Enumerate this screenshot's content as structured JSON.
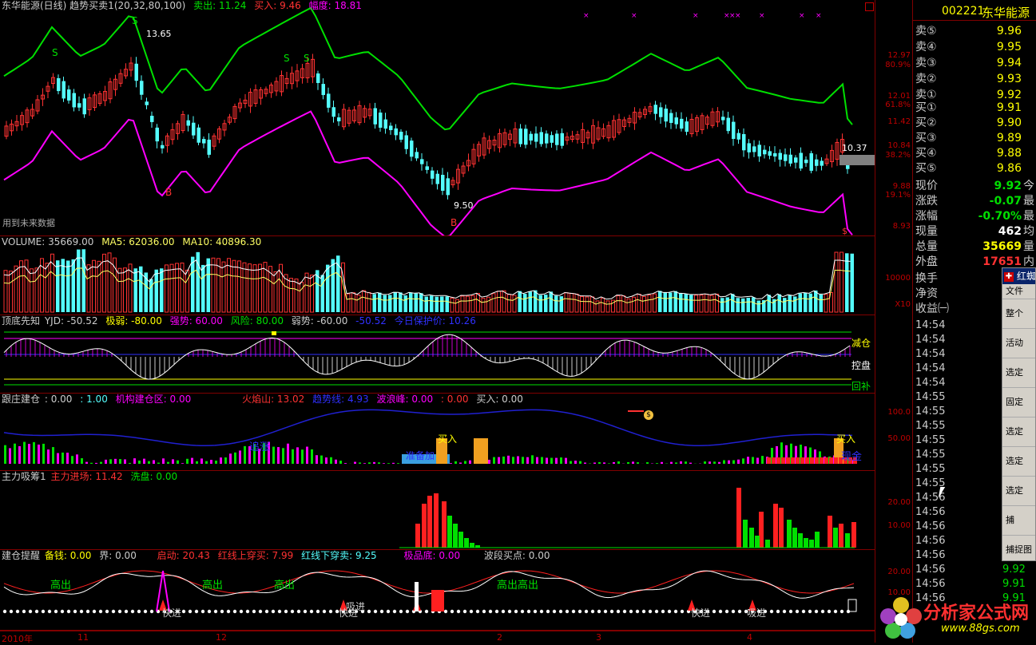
{
  "main_chart": {
    "title": "东华能源(日线) 趋势买卖1(20,32,80,100)",
    "sell_label": "卖出: 11.24",
    "buy_label": "买入: 9.46",
    "range_label": "幅度: 18.81",
    "future_data_note": "用到未来数据",
    "high_mark": "13.65",
    "low_mark": "9.50",
    "last_mark": "10.37",
    "markers": {
      "s": "S",
      "b": "B"
    },
    "price_axis": [
      "12.97",
      "80.9%",
      "12.01",
      "61.8%",
      "11.42",
      "10.84",
      "38.2%",
      "9.88",
      "19.1%",
      "8.93"
    ],
    "colors": {
      "up": "#ff3232",
      "down": "#54fcfc",
      "upper_band": "#00e000",
      "lower_band": "#ff00ff"
    }
  },
  "volume_panel": {
    "label": "VOLUME: 35669.00",
    "ma5": "MA5: 62036.00",
    "ma10": "MA10: 40896.30",
    "axis": [
      "10000",
      "X10"
    ]
  },
  "dingdi_panel": {
    "name": "顶底先知",
    "yjd": "YJD: -50.52",
    "jiruo": "极弱: -80.00",
    "qiangshi": "强势: 60.00",
    "fengxian": "风险: 80.00",
    "ruoshi": "弱势: -60.00",
    "val": "-50.52",
    "baohu": "今日保护价: 10.26",
    "tags": [
      "减仓",
      "控盘",
      "回补"
    ]
  },
  "genzhuang_panel": {
    "name": "跟庄建仓",
    "v1": ": 0.00",
    "v2": ": 1.00",
    "jigou": "机构建仓区: 0.00",
    "huoyan": "火焰山: 13.02",
    "qushi": "趋势线: 4.93",
    "bolang": "波浪峰: 0.00",
    "v3": ": 0.00",
    "mairu": "买入: 0.00",
    "axis": [
      "100.0",
      "50.00"
    ],
    "texts": {
      "zhuizhang": "追涨",
      "zhunbei": "准备加",
      "mairu": "买入",
      "xianjin": "现金"
    }
  },
  "zhuli_panel": {
    "name": "主力吸筹1",
    "jinchang": "主力进场: 11.42",
    "xipan": "洗盘: 0.00",
    "axis": [
      "20.00",
      "10.00"
    ]
  },
  "jiancang_panel": {
    "name": "建仓提醒",
    "beiqian": "备钱: 0.00",
    "jie": "界: 0.00",
    "qidong": "启动: 20.43",
    "hongxian_up": "红线上穿买: 7.99",
    "hongxian_down": "红线下穿卖: 9.25",
    "jipindi": "极品底: 0.00",
    "boduan": "波段买点: 0.00",
    "axis": [
      "20.00",
      "10.00"
    ],
    "texts": {
      "gaochu": "高出",
      "gaochu2": "高出高出",
      "kuaijin": "快进",
      "xijin": "吸进"
    }
  },
  "date_axis": [
    "2010年",
    "11",
    "12",
    "2",
    "3",
    "4"
  ],
  "quote": {
    "code": "002221",
    "name": "东华能源",
    "asks": [
      {
        "label": "卖⑤",
        "price": "9.96"
      },
      {
        "label": "卖④",
        "price": "9.95"
      },
      {
        "label": "卖③",
        "price": "9.94"
      },
      {
        "label": "卖②",
        "price": "9.93"
      },
      {
        "label": "卖①",
        "price": "9.92"
      }
    ],
    "bids": [
      {
        "label": "买①",
        "price": "9.91"
      },
      {
        "label": "买②",
        "price": "9.90"
      },
      {
        "label": "买③",
        "price": "9.89"
      },
      {
        "label": "买④",
        "price": "9.88"
      },
      {
        "label": "买⑤",
        "price": "9.86"
      }
    ],
    "stats": [
      {
        "label": "现价",
        "value": "9.92",
        "suffix": "今",
        "color": "#00e000"
      },
      {
        "label": "涨跌",
        "value": "-0.07",
        "suffix": "最",
        "color": "#00e000"
      },
      {
        "label": "涨幅",
        "value": "-0.70%",
        "suffix": "最",
        "color": "#00e000"
      },
      {
        "label": "现量",
        "value": "462",
        "suffix": "均",
        "color": "#ffffff"
      },
      {
        "label": "总量",
        "value": "35669",
        "suffix": "量",
        "color": "#ffff00"
      },
      {
        "label": "外盘",
        "value": "17651",
        "suffix": "内",
        "color": "#ff3232"
      },
      {
        "label": "换手",
        "value": "1.",
        "suffix": "",
        "color": "#ffffff"
      },
      {
        "label": "净资",
        "value": "",
        "suffix": "",
        "color": "#ffffff"
      },
      {
        "label": "收益㈠",
        "value": "0.",
        "suffix": "",
        "color": "#ffffff"
      }
    ],
    "ticks": [
      "14:54",
      "14:54",
      "14:54",
      "14:54",
      "14:54",
      "14:55",
      "14:55",
      "14:55",
      "14:55",
      "14:55",
      "14:55",
      "14:55",
      "14:56",
      "14:56",
      "14:56",
      "14:56",
      "14:56",
      "14:56",
      "14:56",
      "14:56"
    ],
    "tick_prices": [
      "9.92",
      "9.91",
      "9.91"
    ]
  },
  "popup": {
    "title": "红蜘",
    "items": [
      "文件",
      "整个",
      "活动",
      "选定",
      "固定",
      "选定",
      "选定",
      "选定",
      "捕",
      "捕捉图"
    ]
  },
  "watermark": {
    "text": "分析家公式网",
    "url": "www.88gs.com"
  }
}
